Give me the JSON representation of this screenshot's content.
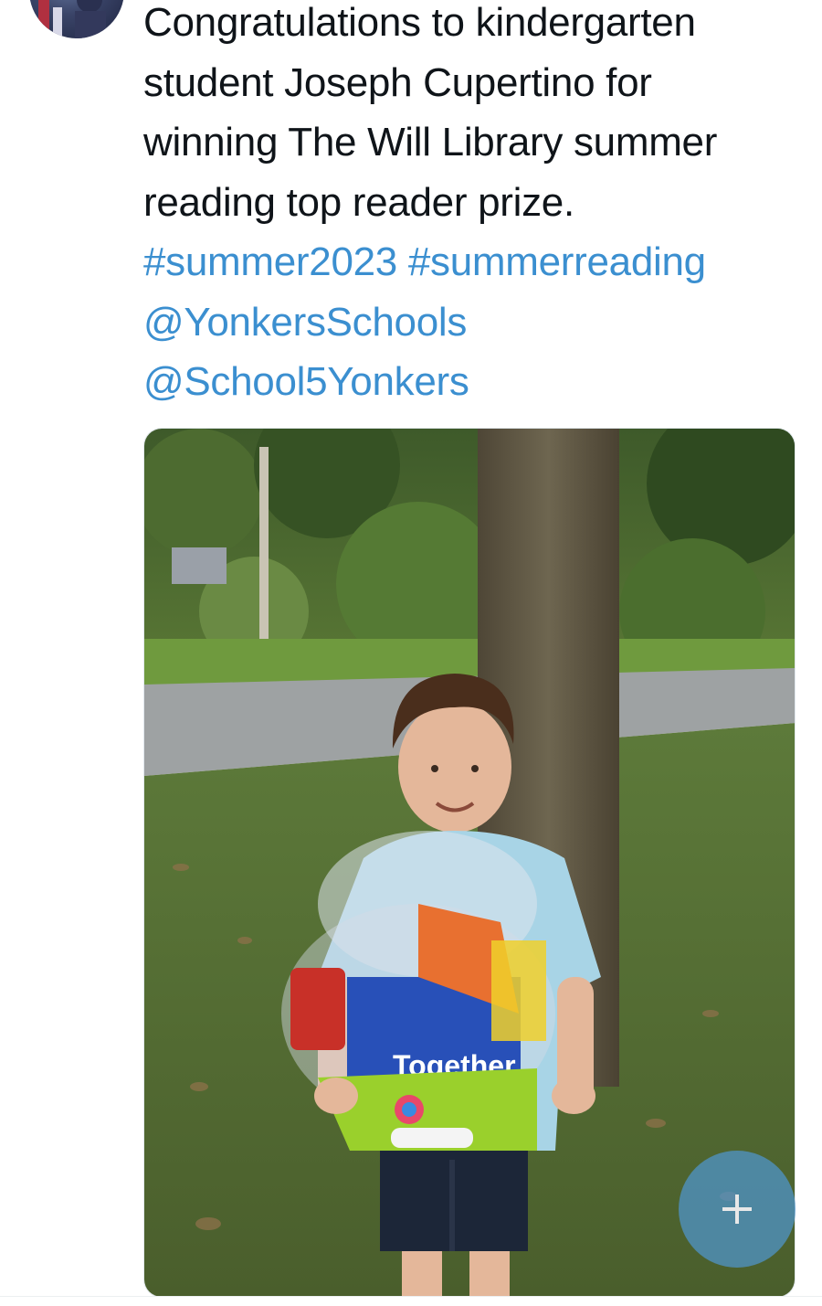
{
  "tweet": {
    "text_lines": [
      "Congratulations to kindergarten",
      "student Joseph Cupertino for",
      "winning The Will Library summer",
      "reading top reader prize."
    ],
    "hashtags": [
      "#summer2023",
      "#summerreading"
    ],
    "mentions": [
      "@YonkersSchools",
      "@School5Yonkers"
    ]
  },
  "media": {
    "photo_text": "Together"
  },
  "compose_button": {
    "icon": "plus-icon"
  },
  "colors": {
    "text": "#0f1419",
    "link": "#3b8fd0",
    "fab": "#4f96ce"
  }
}
